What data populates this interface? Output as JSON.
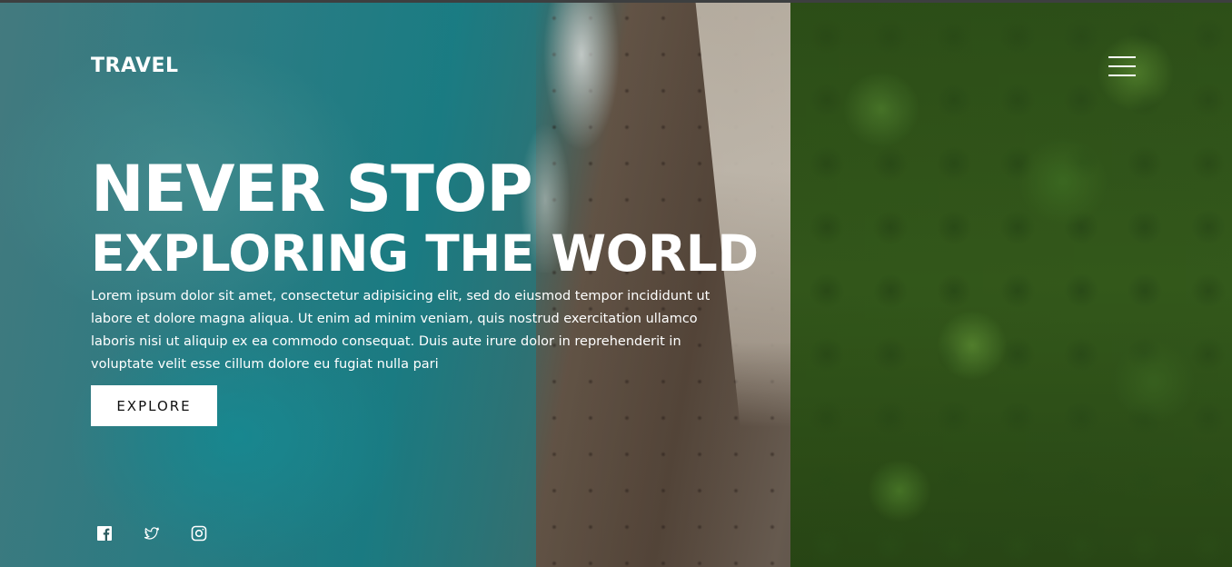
{
  "brand": {
    "logo_text": "TRAVEL"
  },
  "nav": {
    "menu_icon": "hamburger-menu-icon"
  },
  "hero": {
    "title_line1": "NEVER STOP",
    "title_line2": "EXPLORING THE WORLD",
    "description": "Lorem ipsum dolor sit amet, consectetur adipisicing elit, sed do eiusmod tempor incididunt ut labore et dolore magna aliqua. Ut enim ad minim veniam, quis nostrud exercitation ullamco laboris nisi ut aliquip ex ea commodo consequat. Duis aute irure dolor in reprehenderit in voluptate velit esse cillum dolore eu fugiat nulla pari",
    "cta_label": "EXPLORE"
  },
  "social": {
    "icons": [
      "facebook-icon",
      "twitter-icon",
      "instagram-icon"
    ]
  },
  "colors": {
    "text": "#ffffff",
    "button_bg": "#ffffff",
    "button_text": "#111111"
  }
}
